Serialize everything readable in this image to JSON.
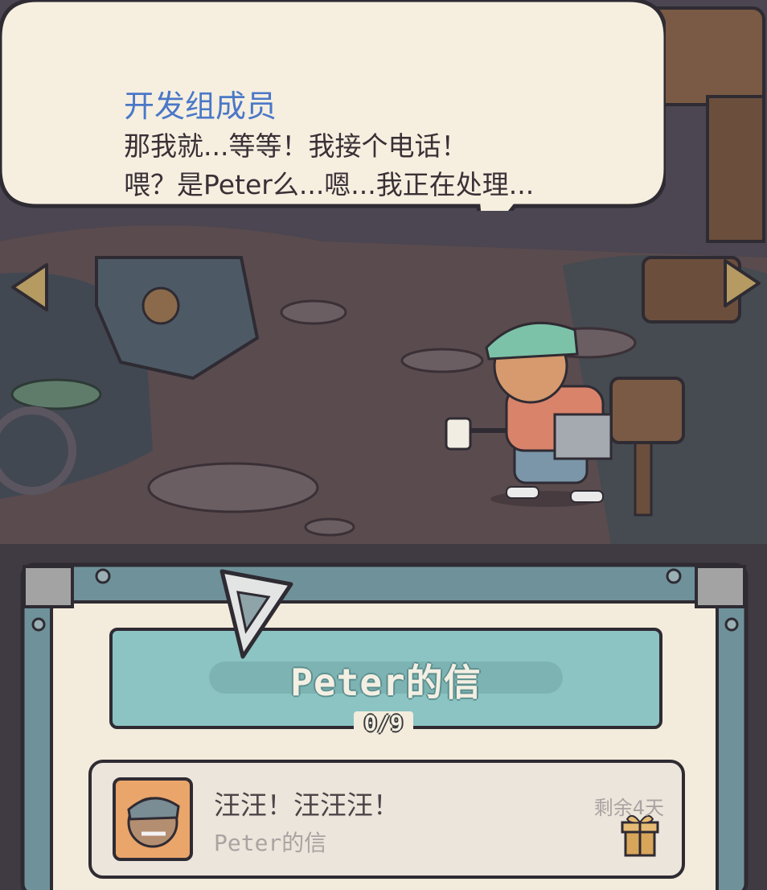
{
  "dialogue": {
    "speaker": "开发组成员",
    "lines": [
      "那我就...等等！我接个电话！",
      "喂？是Peter么...嗯...我正在处理..."
    ]
  },
  "nav": {
    "prev_icon": "triangle-left-icon",
    "next_icon": "triangle-right-icon"
  },
  "letters_panel": {
    "title": "Peter的信",
    "progress": "0/9",
    "items": [
      {
        "title": "汪汪！汪汪汪！",
        "subtitle": "Peter的信",
        "time_left": "剩余4天",
        "reward_icon": "gift-icon",
        "avatar_icon": "dog-avatar-icon"
      }
    ]
  },
  "colors": {
    "speaker_name": "#4a78c8",
    "bubble": "#f6efe0",
    "panel_teal": "#8cc4c4",
    "panel_frame": "#6a8c94"
  }
}
